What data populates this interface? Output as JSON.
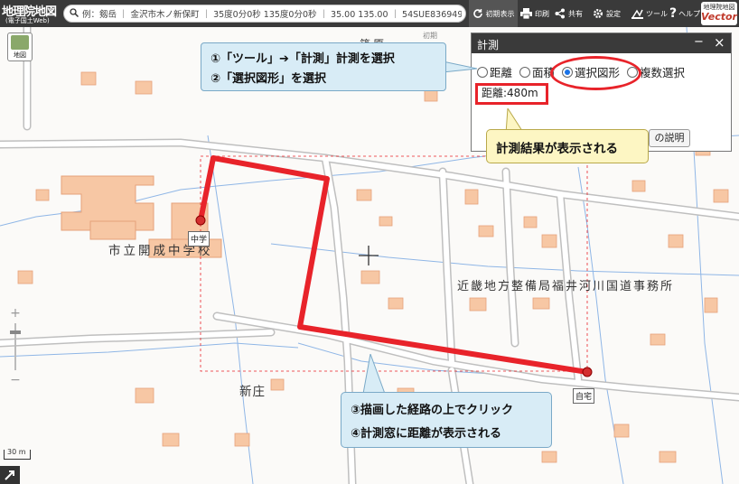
{
  "header": {
    "logo_title": "地理院地図",
    "logo_subtitle": "(電子国土Web)",
    "search_placeholder": "例：剱岳 ｜ 金沢市木ノ新保町 ｜ 35度0分0秒 135度0分0秒 ｜ 35.00 135.00 ｜ 54SUE83694920",
    "buttons": {
      "initial_view": "初期表示",
      "print": "印刷",
      "share": "共有",
      "settings": "設定",
      "tools": "ツール",
      "help": "ヘルプ"
    },
    "vector_badge": {
      "top": "地理院地図",
      "bottom": "Vector"
    }
  },
  "map": {
    "layer_button": "地図",
    "labels": {
      "school": "市立開成中学校",
      "office": "近畿地方整備局福井河川国道事務所",
      "shinsho": "新庄",
      "shinohara_partial": "篠原",
      "partial_top": "初期"
    },
    "pins": {
      "school_pin": "中学",
      "home_pin": "自宅"
    },
    "scale_label": "30 m",
    "zoom": {
      "in": "+",
      "out": "−"
    }
  },
  "measure_window": {
    "title": "計測",
    "minimize": "−",
    "close": "×",
    "options": [
      "距離",
      "面積",
      "選択図形",
      "複数選択"
    ],
    "selected_option": "選択図形",
    "result": "距離:480m",
    "help_button": "の説明"
  },
  "callouts": {
    "top_line1": "①「ツール」➔「計測」計測を選択",
    "top_line2": "②「選択図形」を選択",
    "result_note": "計測結果が表示される",
    "bottom_line1": "③描画した経路の上でクリック",
    "bottom_line2": "④計測窓に距離が表示される"
  },
  "colors": {
    "route": "#e8232a",
    "highlight": "#e8232a",
    "callout_blue": "#d8ecf6",
    "callout_yellow": "#fdf6c3",
    "topbar": "#3a3a3a"
  }
}
